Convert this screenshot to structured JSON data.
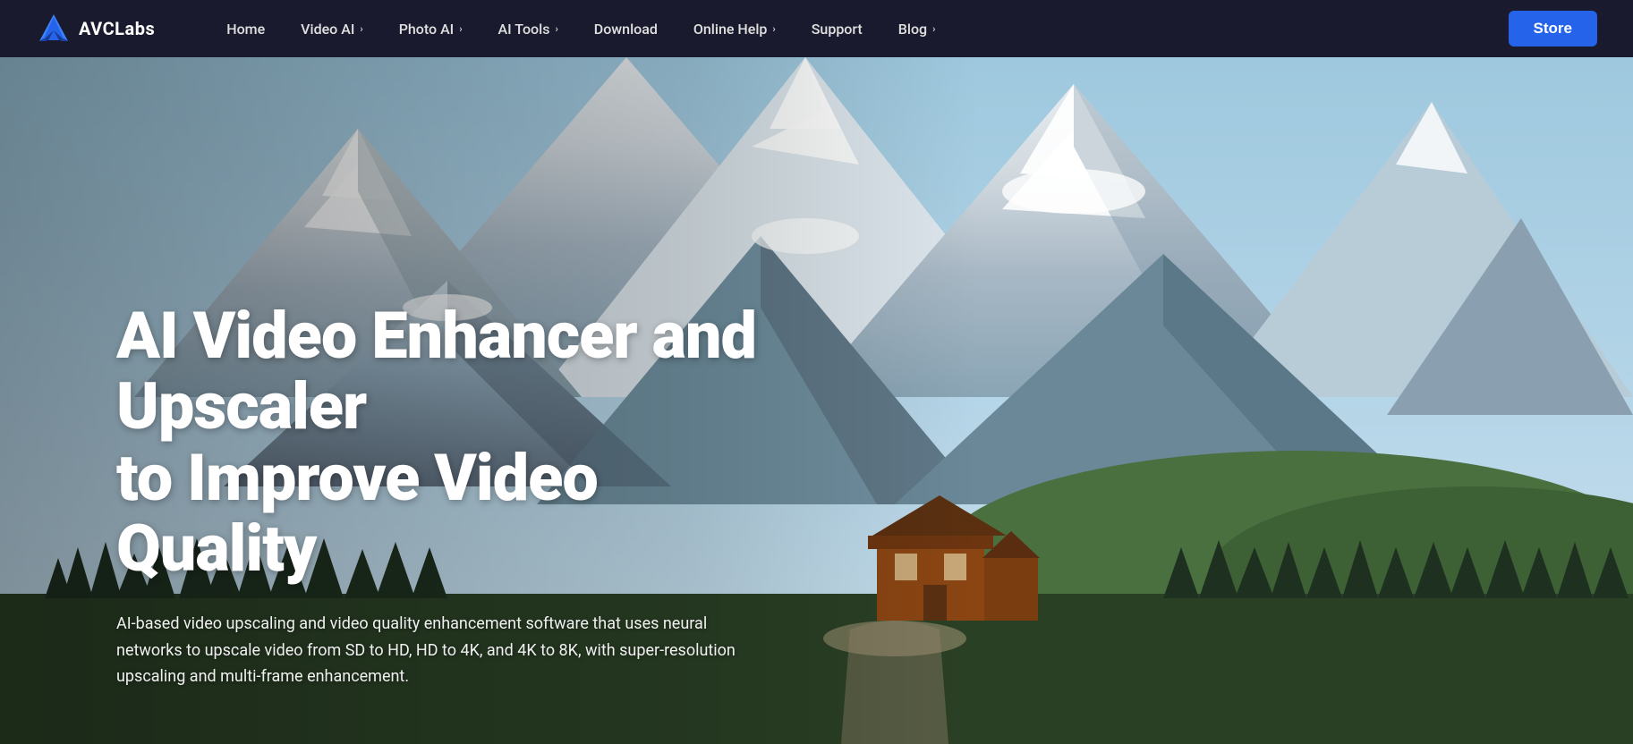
{
  "brand": {
    "name": "AVCLabs",
    "logo_alt": "AVCLabs Logo"
  },
  "navbar": {
    "links": [
      {
        "label": "Home",
        "has_dropdown": false
      },
      {
        "label": "Video AI",
        "has_dropdown": true
      },
      {
        "label": "Photo AI",
        "has_dropdown": true
      },
      {
        "label": "AI Tools",
        "has_dropdown": true
      },
      {
        "label": "Download",
        "has_dropdown": false
      },
      {
        "label": "Online Help",
        "has_dropdown": true
      },
      {
        "label": "Support",
        "has_dropdown": false
      },
      {
        "label": "Blog",
        "has_dropdown": true
      }
    ],
    "store_button": "Store"
  },
  "hero": {
    "title_line1": "AI Video Enhancer and Upscaler",
    "title_line2": "to Improve Video Quality",
    "subtitle": "AI-based video upscaling and video quality enhancement software that uses neural networks to upscale video from SD to HD, HD to 4K, and 4K to 8K, with super-resolution upscaling and multi-frame enhancement."
  }
}
